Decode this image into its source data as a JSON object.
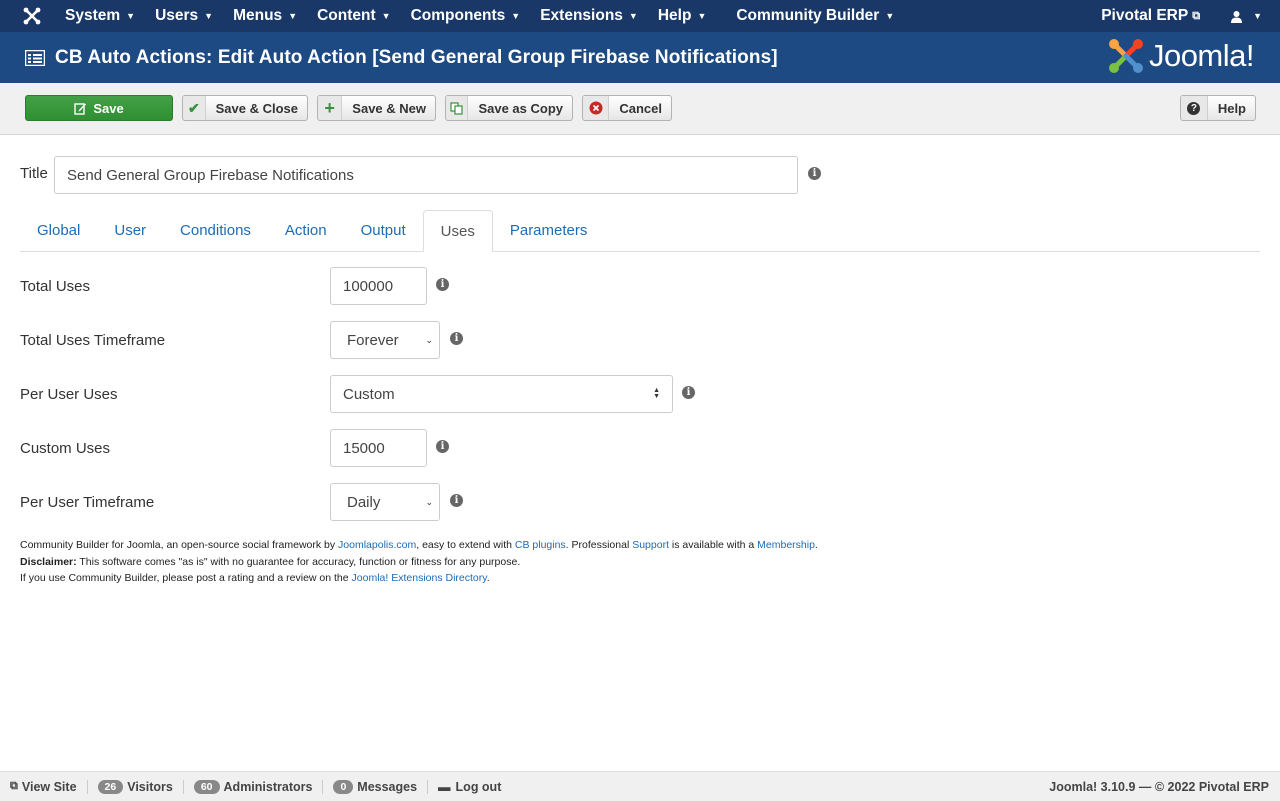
{
  "topnav": {
    "menus": [
      {
        "label": "System",
        "name": "menu-system"
      },
      {
        "label": "Users",
        "name": "menu-users"
      },
      {
        "label": "Menus",
        "name": "menu-menus"
      },
      {
        "label": "Content",
        "name": "menu-content"
      },
      {
        "label": "Components",
        "name": "menu-components"
      },
      {
        "label": "Extensions",
        "name": "menu-extensions"
      },
      {
        "label": "Help",
        "name": "menu-help"
      },
      {
        "label": "Community Builder",
        "name": "menu-community-builder"
      }
    ],
    "site_link": "Pivotal ERP",
    "icons": {
      "logo": "joomla-logo-icon",
      "external": "external-link-icon",
      "user": "user-icon"
    }
  },
  "header": {
    "title": "CB Auto Actions: Edit Auto Action [Send General Group Firebase Notifications]",
    "brand": "Joomla!",
    "brand_colors": [
      "#f9a541",
      "#f44321",
      "#5091cd",
      "#7ac143"
    ]
  },
  "toolbar": {
    "save": "Save",
    "save_close": "Save & Close",
    "save_new": "Save & New",
    "save_copy": "Save as Copy",
    "cancel": "Cancel",
    "help": "Help"
  },
  "form": {
    "title_label": "Title",
    "title_value": "Send General Group Firebase Notifications",
    "tabs": [
      "Global",
      "User",
      "Conditions",
      "Action",
      "Output",
      "Uses",
      "Parameters"
    ],
    "active_tab": "Uses",
    "fields": {
      "total_uses": {
        "label": "Total Uses",
        "value": "100000"
      },
      "total_uses_timeframe": {
        "label": "Total Uses Timeframe",
        "value": "Forever"
      },
      "per_user_uses": {
        "label": "Per User Uses",
        "value": "Custom"
      },
      "custom_uses": {
        "label": "Custom Uses",
        "value": "15000"
      },
      "per_user_timeframe": {
        "label": "Per User Timeframe",
        "value": "Daily"
      }
    }
  },
  "footer": {
    "line1_a": "Community Builder for Joomla, an open-source social framework by ",
    "line1_link1": "Joomlapolis.com",
    "line1_b": ", easy to extend with ",
    "line1_link2": "CB plugins",
    "line1_c": ". Professional ",
    "line1_link3": "Support",
    "line1_d": " is available with a ",
    "line1_link4": "Membership",
    "line1_e": ".",
    "line2_bold": "Disclaimer:",
    "line2_text": " This software comes \"as is\" with no guarantee for accuracy, function or fitness for any purpose.",
    "line3_text": "If you use Community Builder, please post a rating and a review on the ",
    "line3_link": "Joomla! Extensions Directory",
    "line3_end": "."
  },
  "statusbar": {
    "view_site": "View Site",
    "visitors_count": "26",
    "visitors_label": "Visitors",
    "admins_count": "60",
    "admins_label": "Administrators",
    "messages_count": "0",
    "messages_label": "Messages",
    "logout": "Log out",
    "version": "Joomla! 3.10.9 — © 2022 Pivotal ERP"
  },
  "colors": {
    "topnav_bg": "#1a3867",
    "header_bg": "#1d4a83",
    "save_green": "#3a9a3e",
    "link_blue": "#1c6cb6"
  }
}
